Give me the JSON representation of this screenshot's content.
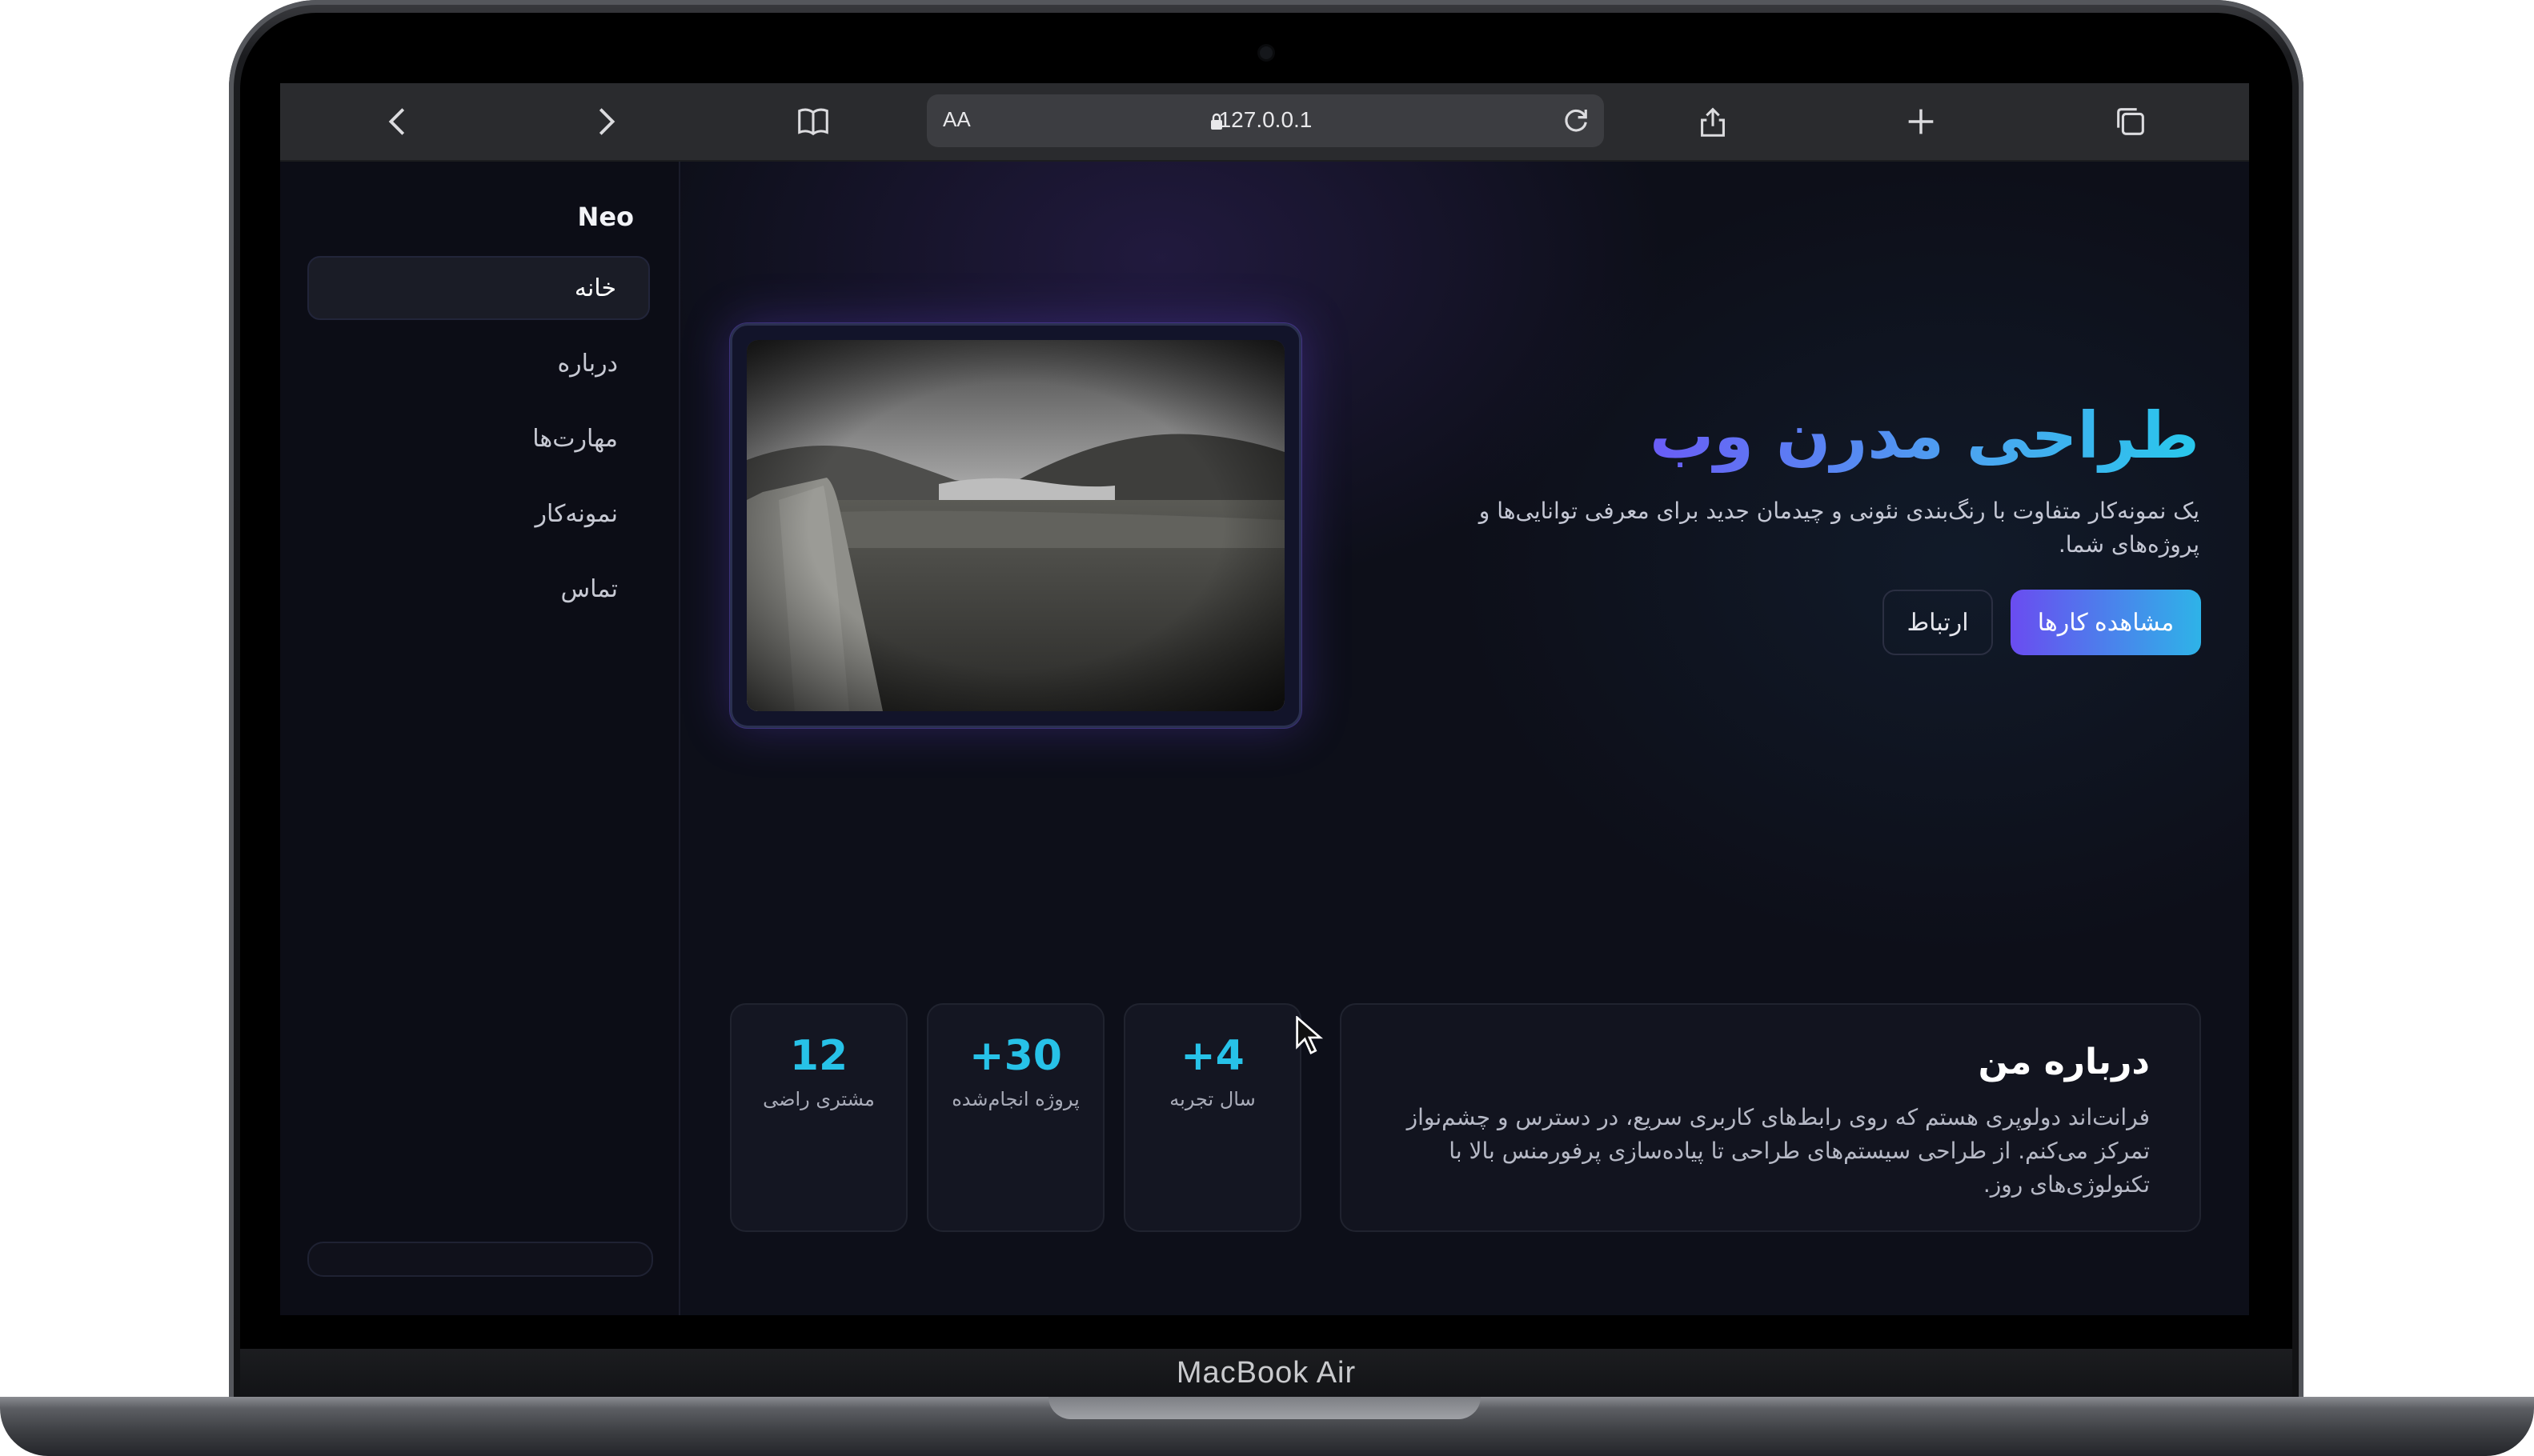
{
  "device": {
    "brand": "MacBook Air"
  },
  "browser": {
    "address": {
      "text_size_label": "AA",
      "url": "127.0.0.1"
    },
    "icons": {
      "back": "chevron-left-icon",
      "forward": "chevron-right-icon",
      "bookmarks": "book-icon",
      "lock": "lock-icon",
      "reload": "reload-icon",
      "share": "share-icon",
      "new_tab": "plus-icon",
      "tabs": "tabs-icon"
    }
  },
  "sidebar": {
    "brand": "Neo",
    "items": [
      {
        "label": "خانه",
        "active": true
      },
      {
        "label": "درباره",
        "active": false
      },
      {
        "label": "مهارت‌ها",
        "active": false
      },
      {
        "label": "نمونه‌کار",
        "active": false
      },
      {
        "label": "تماس",
        "active": false
      }
    ]
  },
  "hero": {
    "title": "طراحی مدرن وب",
    "description": "یک نمونه‌کار متفاوت با رنگ‌بندی نئونی و چیدمان جدید برای معرفی توانایی‌ها و پروژه‌های شما.",
    "primary_button": "مشاهده کارها",
    "secondary_button": "ارتباط"
  },
  "about": {
    "title": "درباره من",
    "text": "فرانت‌اند دولوپری هستم که روی رابط‌های کاربری سریع، در دسترس و چشم‌نواز تمرکز می‌کنم. از طراحی سیستم‌های طراحی تا پیاده‌سازی پرفورمنس بالا با تکنولوژی‌های روز."
  },
  "stats": [
    {
      "value": "12",
      "label": "مشتری راضی"
    },
    {
      "value": "+30",
      "label": "پروژه انجام‌شده"
    },
    {
      "value": "+4",
      "label": "سال تجربه"
    }
  ],
  "colors": {
    "accent_purple": "#6a4cf0",
    "accent_cyan": "#27c2e8",
    "background": "#0d0f19"
  }
}
